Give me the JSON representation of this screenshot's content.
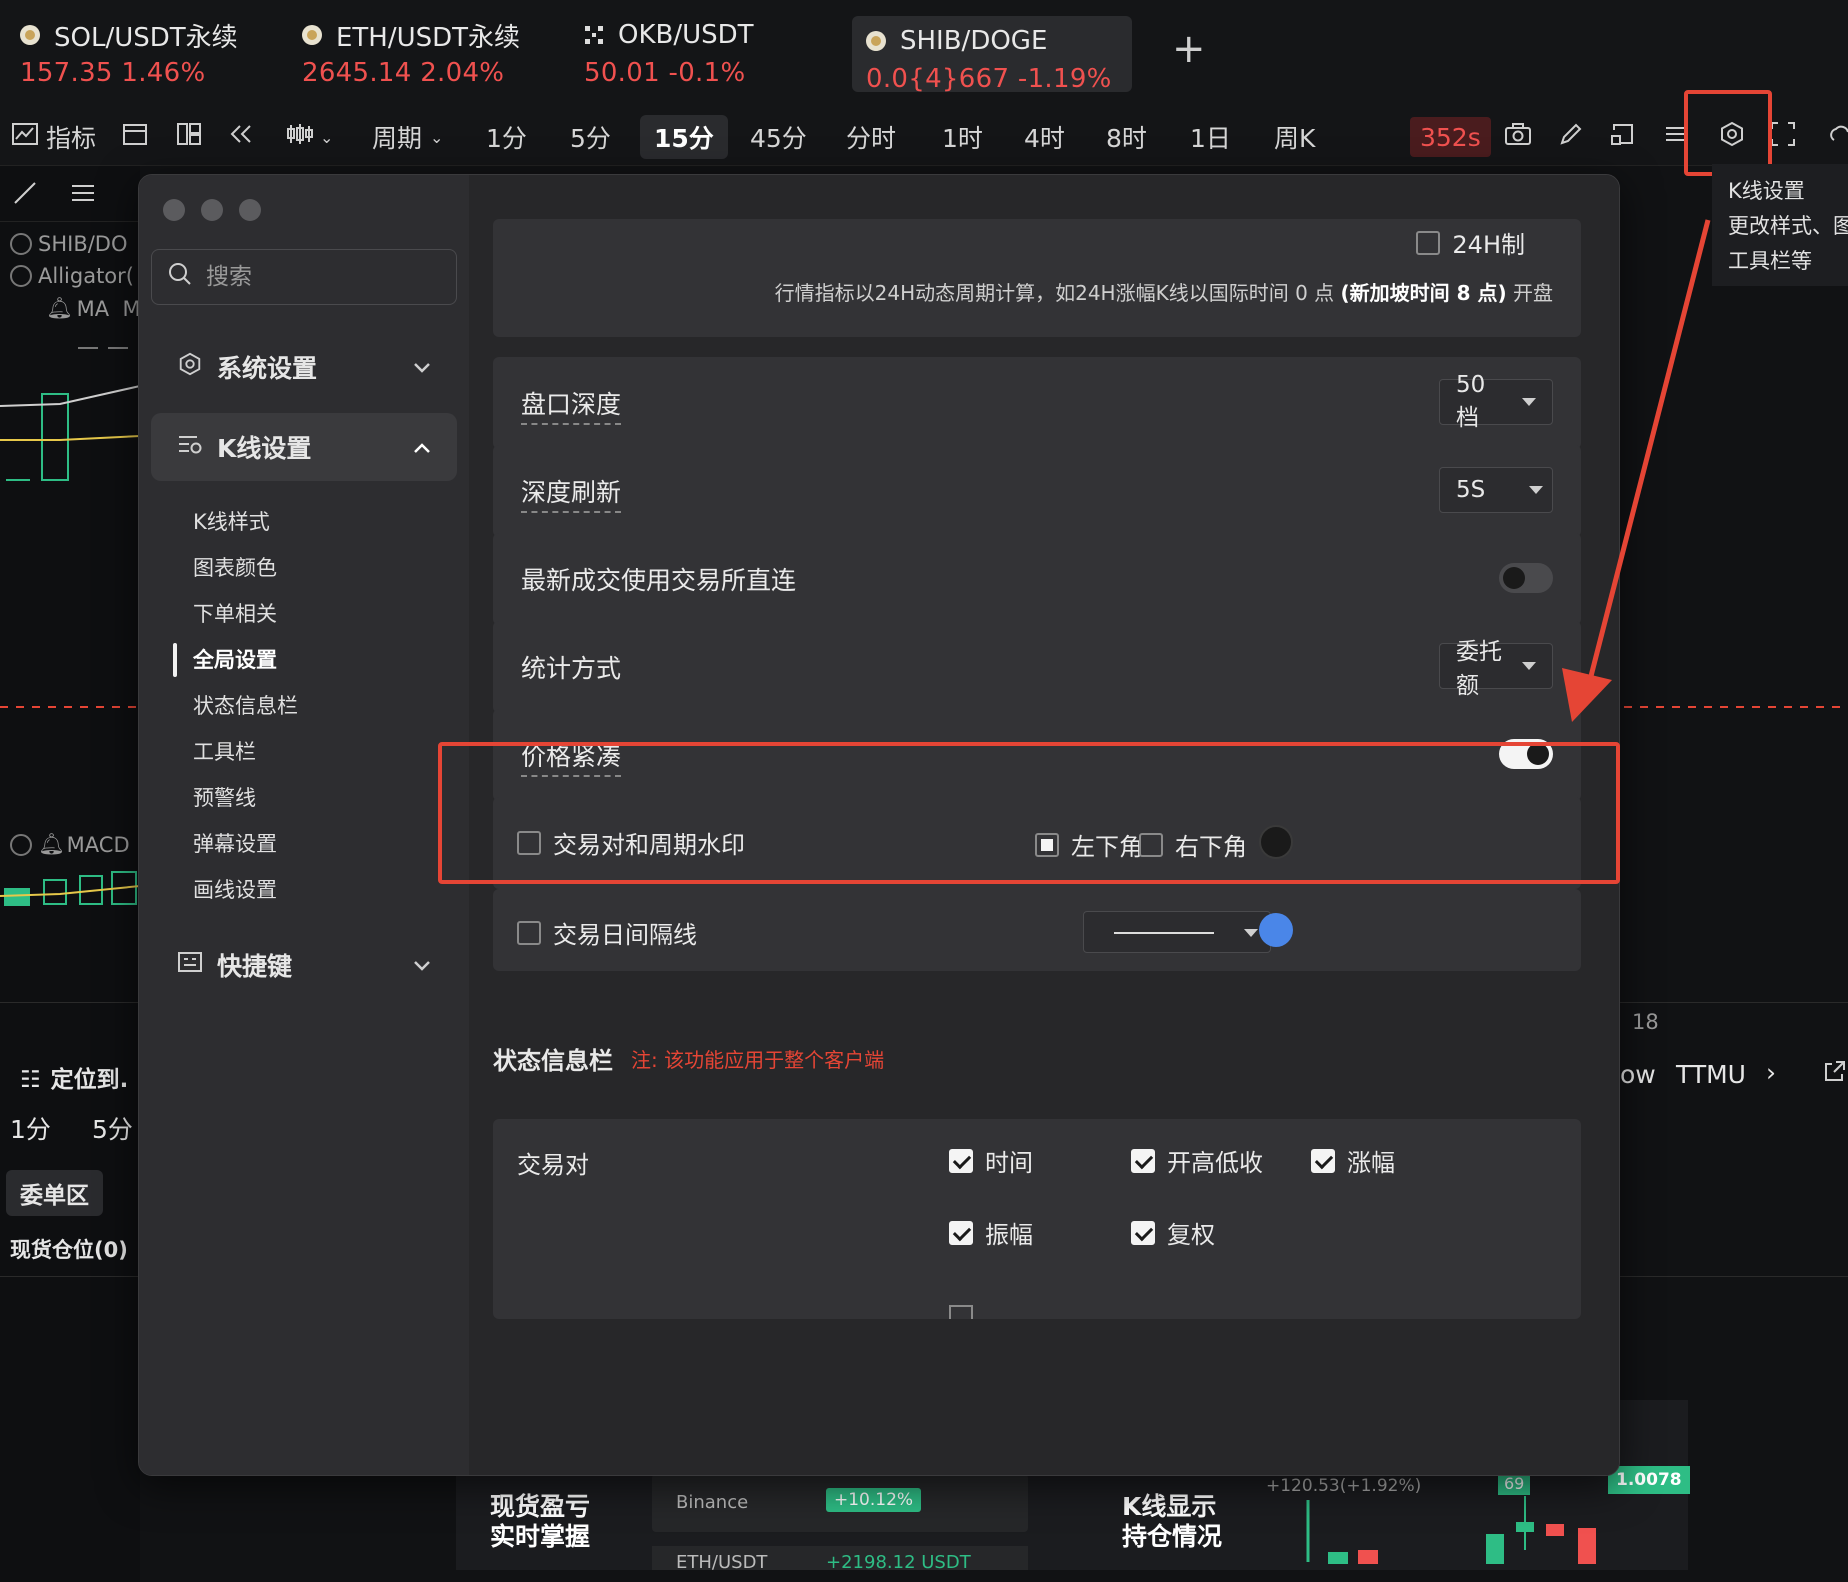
{
  "tickers": [
    {
      "pair": "SOL/USDT永续",
      "price": "157.35",
      "change": "1.46%"
    },
    {
      "pair": "ETH/USDT永续",
      "price": "2645.14",
      "change": "2.04%"
    },
    {
      "pair": "OKB/USDT",
      "price": "50.01",
      "change": "-0.1%"
    },
    {
      "pair": "SHIB/DOGE",
      "price": "0.0{4}667",
      "change": "-1.19%"
    }
  ],
  "add_tab": "+",
  "toolbar": {
    "indicators": "指标",
    "period": "周期",
    "intervals": [
      "1分",
      "5分",
      "15分",
      "45分",
      "分时",
      "1时",
      "4时",
      "8时",
      "1日",
      "周K"
    ],
    "selected_interval": "15分",
    "timer": "352s"
  },
  "tooltip": {
    "title": "K线设置",
    "line1": "更改样式、图",
    "line2": "工具栏等"
  },
  "chart_left": {
    "legend1": "SHIB/DO",
    "legend2": "Alligator(",
    "legend3": "MA",
    "legend3b": "M",
    "macd": "MACD",
    "axis_18": "18",
    "locate": "定位到.",
    "int1": "1分",
    "int2": "5分",
    "orders": "委单区",
    "positions": "现货仓位(0)",
    "right_low": "ow",
    "right_ttmu": "TTMU"
  },
  "dialog": {
    "search_placeholder": "搜索",
    "nav": {
      "system": "系统设置",
      "kline": "K线设置",
      "shortcuts": "快捷键",
      "sub": [
        "K线样式",
        "图表颜色",
        "下单相关",
        "全局设置",
        "状态信息栏",
        "工具栏",
        "预警线",
        "弹幕设置",
        "画线设置"
      ],
      "current": "全局设置"
    },
    "settings": {
      "h24_label": "24H制",
      "h24_note_a": "行情指标以24H动态周期计算，如24H涨幅K线以国际时间 0 点 ",
      "h24_note_b": "(新加坡时间 8 点)",
      "h24_note_c": " 开盘",
      "depth_label": "盘口深度",
      "depth_value": "50档",
      "refresh_label": "深度刷新",
      "refresh_value": "5S",
      "direct_label": "最新成交使用交易所直连",
      "direct_on": false,
      "stat_label": "统计方式",
      "stat_value": "委托额",
      "compact_label": "价格紧凑",
      "compact_on": true,
      "watermark_label": "交易对和周期水印",
      "wm_left": "左下角",
      "wm_right": "右下角",
      "wm_color": "#1a1a1a",
      "dayline_label": "交易日间隔线",
      "dayline_color": "#4a86e8"
    },
    "status_bar": {
      "title": "状态信息栏",
      "note": "注:  该功能应用于整个客户端",
      "pair_label": "交易对",
      "options": [
        "时间",
        "开高低收",
        "涨幅",
        "振幅",
        "复权"
      ]
    }
  },
  "bottom": {
    "promo1_line1": "现货盈亏",
    "promo1_line2": "实时掌握",
    "exchange": "Binance",
    "exchange_change": "+10.12%",
    "pair_clip": "ETH/USDT",
    "pnl_clip": "+2198.12 USDT",
    "promo2_line1": "K线显示",
    "promo2_line2": "持仓情况",
    "price_tag": "1.0078",
    "small_change": "+120.53(+1.92%)",
    "small_num": "69"
  },
  "colors": {
    "accent_red": "#e54535",
    "down_red": "#f0514f",
    "up_green": "#2ebd85",
    "toggle_on": "#f4f4f4"
  }
}
